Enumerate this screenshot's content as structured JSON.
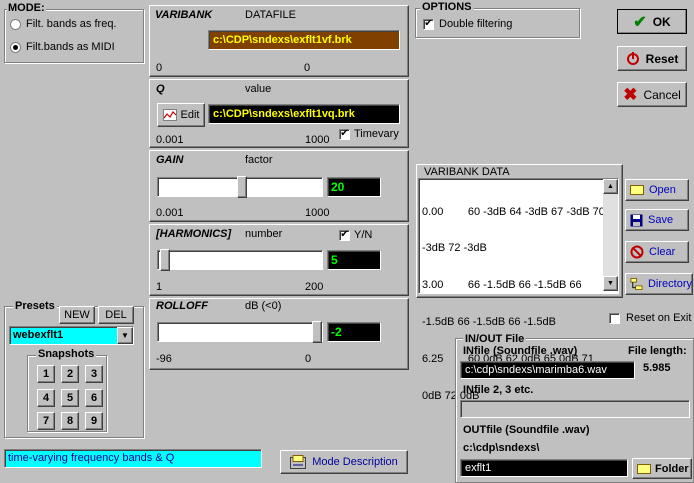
{
  "mode": {
    "title": "MODE:",
    "options": [
      "Filt. bands as freq.",
      "Filt.bands as MIDI"
    ],
    "selected": 1
  },
  "varibank": {
    "label": "VARIBANK",
    "sublabel": "DATAFILE",
    "path": "c:\\CDP\\sndexs\\exflt1vf.brk",
    "min": "0",
    "max": "0"
  },
  "q": {
    "label": "Q",
    "sublabel": "value",
    "edit_label": "Edit",
    "path": "c:\\CDP\\sndexs\\exflt1vq.brk",
    "min": "0.001",
    "max": "1000",
    "timevary_label": "Timevary",
    "timevary_checked": true
  },
  "gain": {
    "label": "GAIN",
    "sublabel": "factor",
    "value": "20",
    "min": "0.001",
    "max": "1000",
    "level": 0.45
  },
  "harmonics": {
    "label": "[HARMONICS]",
    "sublabel": "number",
    "yn_label": "Y/N",
    "yn_checked": true,
    "value": "5",
    "min": "1",
    "max": "200",
    "level": 0.02
  },
  "rolloff": {
    "label": "ROLLOFF",
    "sublabel": "dB (<0)",
    "value": "-2",
    "min": "-96",
    "max": "0",
    "level": 0.98
  },
  "options": {
    "title": "OPTIONS",
    "double_filtering_label": "Double filtering",
    "double_filtering_checked": true
  },
  "actions": {
    "ok_label": "OK",
    "reset_label": "Reset",
    "cancel_label": "Cancel"
  },
  "varibank_data": {
    "title": "VARIBANK  DATA",
    "lines": [
      "0.00        60 -3dB 64 -3dB 67 -3dB 70",
      "-3dB 72 -3dB",
      "3.00        66 -1.5dB 66 -1.5dB 66",
      "-1.5dB 66 -1.5dB 66 -1.5dB",
      "6.25        60 0dB 62 0dB 65 0dB 71",
      "0dB 72 0dB"
    ],
    "open_label": "Open",
    "save_label": "Save",
    "clear_label": "Clear",
    "directory_label": "Directory",
    "reset_on_exit_label": "Reset on Exit"
  },
  "presets": {
    "title": "Presets",
    "new_label": "NEW",
    "del_label": "DEL",
    "selected": "webexflt1",
    "snapshots_title": "Snapshots",
    "snapshots": [
      "1",
      "2",
      "3",
      "4",
      "5",
      "6",
      "7",
      "8",
      "9"
    ]
  },
  "description": {
    "text": "time-varying frequency bands & Q",
    "button_label": "Mode Description"
  },
  "inout": {
    "title": "IN/OUT File",
    "infile_label": "INfile (Soundfile .wav)",
    "file_length_label": "File length:",
    "infile_path": "c:\\cdp\\sndexs\\marimba6.wav",
    "file_length": "5.985",
    "infile2_label": "INfile 2, 3 etc.",
    "infile2_value": "",
    "outfile_label": "OUTfile (Soundfile .wav)",
    "outfile_dir": "c:\\cdp\\sndexs\\",
    "outfile_name": "exflt1",
    "folder_label": "Folder"
  },
  "colors": {
    "varibank_field_bg": "#804000",
    "varibank_field_fg": "#ffff00",
    "q_field_bg": "#000000",
    "q_field_fg": "#ffff00",
    "number_fg": "#00ff00",
    "preset_bg": "#00ffff",
    "description_bg": "#00ffff",
    "button_text_blue": "#0000c0"
  }
}
